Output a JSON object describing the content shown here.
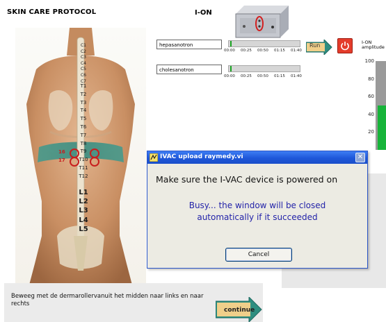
{
  "app": {
    "title": "SKIN CARE PROTOCOL",
    "section_title": "I-ON"
  },
  "vertebrae": [
    "C1",
    "C2",
    "C3",
    "C4",
    "C5",
    "C6",
    "C7",
    "T1",
    "T2",
    "T3",
    "T4",
    "T5",
    "T6",
    "T7",
    "T8",
    "T9",
    "T10",
    "T11",
    "T12",
    "L1",
    "L2",
    "L3",
    "L4",
    "L5"
  ],
  "selected_points": [
    {
      "label": "16",
      "vertebra": "T9"
    },
    {
      "label": "17",
      "vertebra": "T10"
    }
  ],
  "timelines": [
    {
      "name": "hepasanotron",
      "ticks": [
        "00:00",
        "00:25",
        "00:50",
        "01:15",
        "01:40"
      ],
      "progress": 0
    },
    {
      "name": "cholesanotron",
      "ticks": [
        "00:00",
        "00:25",
        "00:50",
        "01:15",
        "01:40"
      ],
      "progress": 0
    }
  ],
  "controls": {
    "run_label": "Run",
    "power_icon": "power-icon"
  },
  "meter": {
    "title_line1": "I-ON",
    "title_line2": "amplitude",
    "ticks": [
      "100",
      "80",
      "60",
      "40",
      "20"
    ],
    "level": 50,
    "max": 100
  },
  "instruction": {
    "text": "Beweeg met de dermarollervanuit het midden naar links en naar rechts",
    "continue_label": "continue"
  },
  "dialog": {
    "title": "IVAC upload raymedy.vi",
    "message": "Make sure the I-VAC device is powered on",
    "busy_line1": "Busy... the window will be closed",
    "busy_line2": "automatically if it succeeded",
    "cancel_label": "Cancel"
  },
  "colors": {
    "accent_red": "#c81e1e",
    "meter_green": "#17b43a",
    "dialog_blue": "#1e57d9",
    "busy_text": "#2323a9"
  }
}
